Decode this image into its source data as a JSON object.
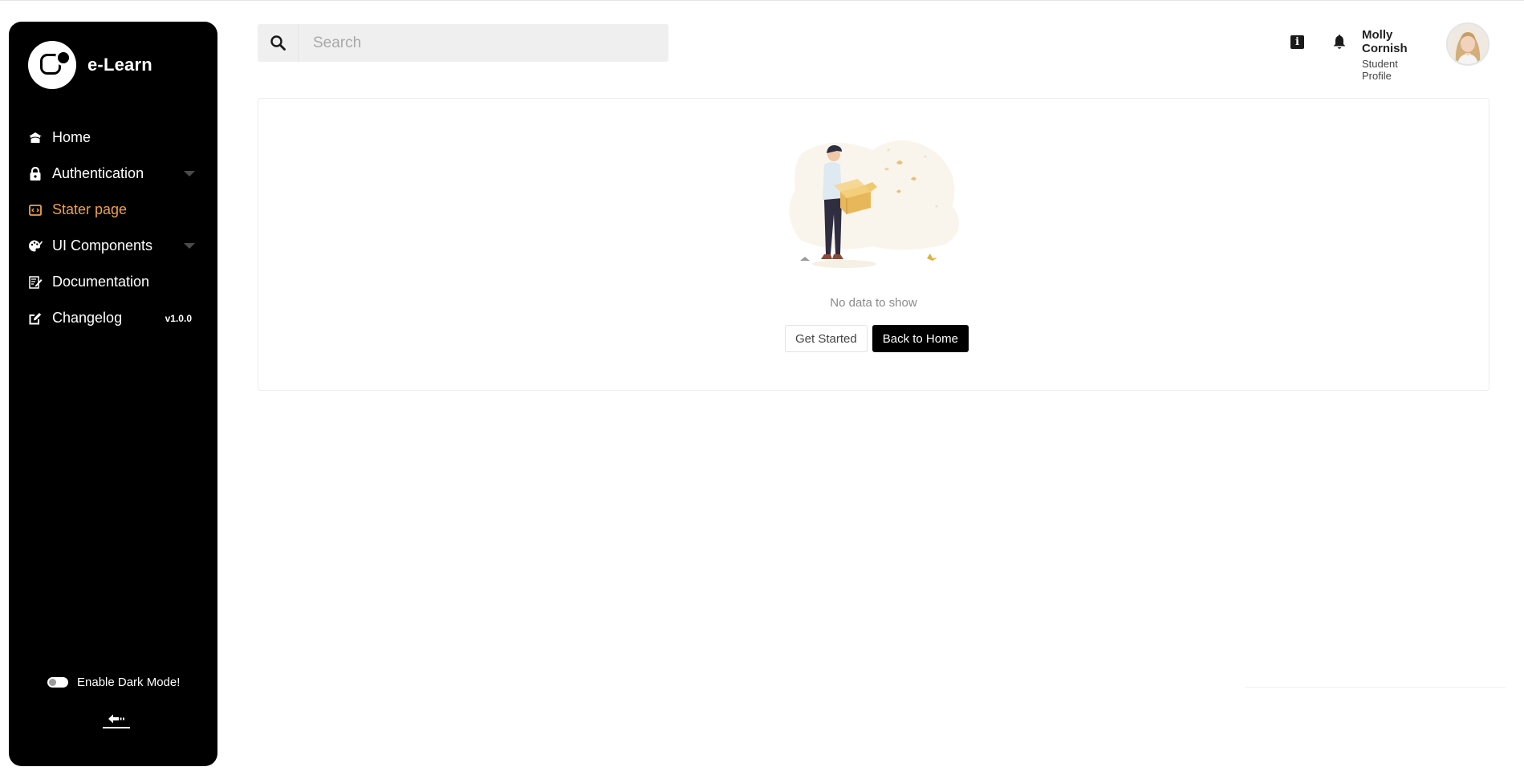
{
  "sidebar": {
    "brand": "e-Learn",
    "items": [
      {
        "label": "Home",
        "icon": "home-icon"
      },
      {
        "label": "Authentication",
        "icon": "lock-icon"
      },
      {
        "label": "Stater page",
        "icon": "code-window-icon"
      },
      {
        "label": "UI Components",
        "icon": "palette-icon"
      },
      {
        "label": "Documentation",
        "icon": "document-edit-icon"
      },
      {
        "label": "Changelog",
        "icon": "edit-square-icon",
        "badge": "v1.0.0"
      }
    ],
    "active_item": "Stater page",
    "dark_mode_label": "Enable Dark Mode!",
    "accent_color": "#f0a04b"
  },
  "header": {
    "search_placeholder": "Search",
    "user_name": "Molly Cornish",
    "user_role": "Student Profile"
  },
  "main": {
    "empty_text": "No data to show",
    "get_started_label": "Get Started",
    "back_home_label": "Back to Home"
  }
}
